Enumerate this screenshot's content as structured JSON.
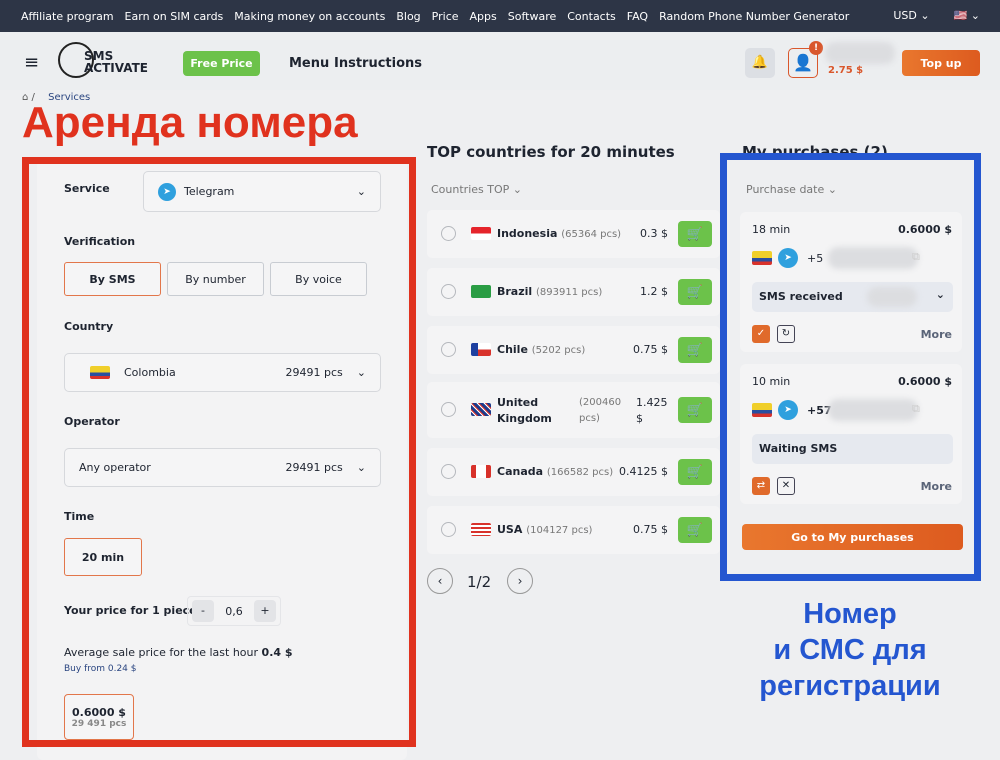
{
  "topnav": {
    "links": [
      "Affiliate program",
      "Earn on SIM cards",
      "Making money on accounts",
      "Blog",
      "Price",
      "Apps",
      "Software",
      "Contacts",
      "FAQ",
      "Random Phone Number Generator"
    ],
    "currency": "USD"
  },
  "header": {
    "logo": "SMS ACTIVATE",
    "free_price": "Free Price",
    "menu": "Menu",
    "instructions": "Instructions",
    "balance": "2.75 $",
    "badge": "!",
    "top_up": "Top up"
  },
  "breadcrumb": {
    "current": "Services"
  },
  "annotations": {
    "rent_title": "Аренда номера",
    "number_sms": [
      "Номер",
      "и СМС для",
      "регистрации"
    ]
  },
  "form": {
    "service_label": "Service",
    "service": "Telegram",
    "verification_label": "Verification",
    "verification_options": [
      "By SMS",
      "By number",
      "By voice"
    ],
    "country_label": "Country",
    "country": "Colombia",
    "country_count": "29491 pcs",
    "operator_label": "Operator",
    "operator": "Any operator",
    "operator_count": "29491 pcs",
    "time_label": "Time",
    "time": "20 min",
    "price_label": "Your price for 1 piece",
    "price_value": "0,6",
    "minus": "-",
    "plus": "+",
    "avg_label": "Average sale price for the last hour",
    "avg_value": "0.4 $",
    "buy_from": "Buy from 0.24 $",
    "offer_price": "0.6000 $",
    "offer_count": "29 491 pcs"
  },
  "top": {
    "title": "TOP countries for 20 minutes",
    "sort": "Countries TOP",
    "countries": [
      {
        "name": "Indonesia",
        "pcs": "(65364 pcs)",
        "price": "0.3 $"
      },
      {
        "name": "Brazil",
        "pcs": "(893911 pcs)",
        "price": "1.2 $"
      },
      {
        "name": "Chile",
        "pcs": "(5202 pcs)",
        "price": "0.75 $"
      },
      {
        "name": "United Kingdom",
        "pcs": "(200460 pcs)",
        "price": "1.425 $"
      },
      {
        "name": "Canada",
        "pcs": "(166582 pcs)",
        "price": "0.4125 $"
      },
      {
        "name": "USA",
        "pcs": "(104127 pcs)",
        "price": "0.75 $"
      }
    ],
    "page": "1/2"
  },
  "purchases": {
    "title": "My purchases (2)",
    "sort": "Purchase date",
    "items": [
      {
        "time": "18 min",
        "price": "0.6000 $",
        "phone": "+5",
        "status": "SMS received",
        "more": "More"
      },
      {
        "time": "10 min",
        "price": "0.6000 $",
        "phone": "+57",
        "status": "Waiting SMS",
        "more": "More"
      }
    ],
    "go": "Go to My purchases"
  }
}
